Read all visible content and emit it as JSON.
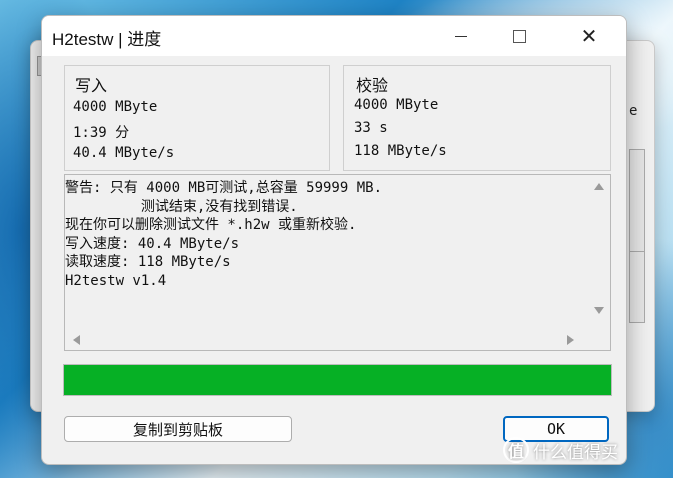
{
  "window": {
    "title": "H2testw | 进度",
    "close_glyph": "✕"
  },
  "write_group": {
    "title": "写入",
    "size": "4000 MByte",
    "time": "1:39 分",
    "speed": "40.4 MByte/s"
  },
  "verify_group": {
    "title": "校验",
    "size": "4000 MByte",
    "time": "33 s",
    "speed": "118 MByte/s"
  },
  "log": {
    "lines": "警告: 只有 4000 MB可测试,总容量 59999 MB.\n         测试结束,没有找到错误.\n现在你可以删除测试文件 *.h2w 或重新校验.\n写入速度: 40.4 MByte/s\n读取速度: 118 MByte/s\nH2testw v1.4"
  },
  "progress": {
    "fraction": 1.0,
    "color": "#06b025"
  },
  "buttons": {
    "copy_label": "复制到剪贴板",
    "ok_label": "OK"
  },
  "background": {
    "partial_letter": "e"
  },
  "watermark": {
    "mark": "值",
    "text": "什么值得买"
  },
  "icons": [
    "minimize-icon",
    "maximize-icon",
    "close-icon",
    "scroll-up-arrow-icon",
    "scroll-down-arrow-icon",
    "scroll-left-arrow-icon",
    "scroll-right-arrow-icon"
  ]
}
